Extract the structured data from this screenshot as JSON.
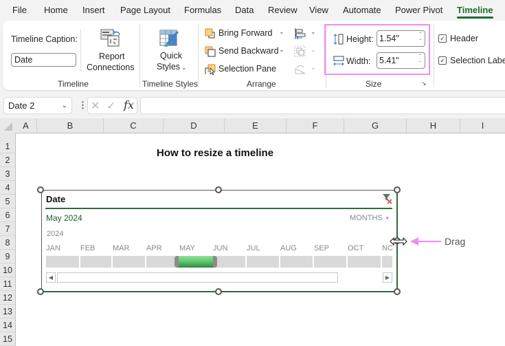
{
  "menu": {
    "tabs": [
      {
        "label": "File"
      },
      {
        "label": "Home"
      },
      {
        "label": "Insert"
      },
      {
        "label": "Page Layout"
      },
      {
        "label": "Formulas"
      },
      {
        "label": "Data"
      },
      {
        "label": "Review"
      },
      {
        "label": "View"
      },
      {
        "label": "Automate"
      },
      {
        "label": "Power Pivot"
      },
      {
        "label": "Timeline"
      }
    ],
    "active_tab": "Timeline"
  },
  "ribbon": {
    "timeline_group": {
      "caption_label": "Timeline Caption:",
      "caption_value": "Date",
      "report_connections_line1": "Report",
      "report_connections_line2": "Connections",
      "group_label": "Timeline"
    },
    "styles_group": {
      "quick_styles_line1": "Quick",
      "quick_styles_line2": "Styles",
      "group_label": "Timeline Styles"
    },
    "arrange_group": {
      "bring_forward": "Bring Forward",
      "send_backward": "Send Backward",
      "selection_pane": "Selection Pane",
      "group_label": "Arrange"
    },
    "size_group": {
      "height_label": "Height:",
      "height_value": "1.54\"",
      "width_label": "Width:",
      "width_value": "5.41\"",
      "group_label": "Size"
    },
    "show_group": {
      "header_label": "Header",
      "header_checked": true,
      "selection_label": "Selection Label",
      "selection_label_checked": true
    }
  },
  "formula_bar": {
    "name_box": "Date 2",
    "formula": ""
  },
  "grid": {
    "columns": [
      "A",
      "B",
      "C",
      "D",
      "E",
      "F",
      "G",
      "H",
      "I"
    ],
    "rows": [
      "1",
      "2",
      "3",
      "4",
      "5",
      "6",
      "7",
      "8",
      "9",
      "10",
      "11",
      "12",
      "13",
      "14",
      "15"
    ]
  },
  "sheet": {
    "title": "How to resize a timeline",
    "annotation": "Drag",
    "annotation_color": "#f28cf0"
  },
  "timeline": {
    "caption": "Date",
    "selection_label": "May 2024",
    "time_level": "MONTHS",
    "year": "2024",
    "months": [
      "JAN",
      "FEB",
      "MAR",
      "APR",
      "MAY",
      "JUN",
      "JUL",
      "AUG",
      "SEP",
      "OCT",
      "NC"
    ],
    "selected_month": "MAY",
    "accent_color": "#2e6b36"
  }
}
